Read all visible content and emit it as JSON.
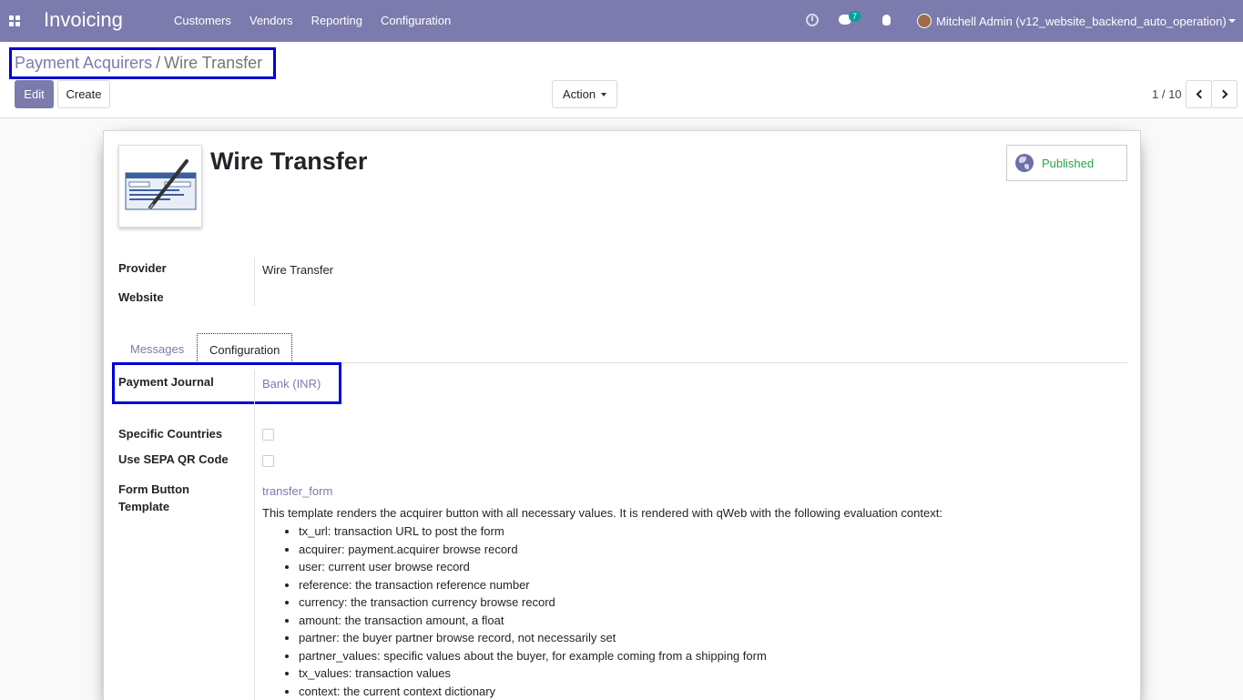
{
  "navbar": {
    "app_title": "Invoicing",
    "menu": [
      "Customers",
      "Vendors",
      "Reporting",
      "Configuration"
    ],
    "chat_count": "7",
    "user": "Mitchell Admin (v12_website_backend_auto_operation)"
  },
  "control_panel": {
    "breadcrumb_parent": "Payment Acquirers",
    "breadcrumb_separator": "/",
    "breadcrumb_current": "Wire Transfer",
    "edit_label": "Edit",
    "create_label": "Create",
    "action_label": "Action",
    "pager_value": "1 / 10"
  },
  "record": {
    "title": "Wire Transfer",
    "published_label": "Published",
    "provider_label": "Provider",
    "provider_value": "Wire Transfer",
    "website_label": "Website",
    "website_value": ""
  },
  "tabs": {
    "messages": "Messages",
    "configuration": "Configuration"
  },
  "config": {
    "payment_journal_label": "Payment Journal",
    "payment_journal_value": "Bank (INR)",
    "specific_countries_label": "Specific Countries",
    "specific_countries_checked": false,
    "sepa_qr_label": "Use SEPA QR Code",
    "sepa_qr_checked": false,
    "form_button_label_line1": "Form Button",
    "form_button_label_line2": "Template",
    "form_button_value": "transfer_form",
    "description": "This template renders the acquirer button with all necessary values. It is rendered with qWeb with the following evaluation context:",
    "context_items": [
      "tx_url: transaction URL to post the form",
      "acquirer: payment.acquirer browse record",
      "user: current user browse record",
      "reference: the transaction reference number",
      "currency: the transaction currency browse record",
      "amount: the transaction amount, a float",
      "partner: the buyer partner browse record, not necessarily set",
      "partner_values: specific values about the buyer, for example coming from a shipping form",
      "tx_values: transaction values",
      "context: the current context dictionary"
    ]
  },
  "colors": {
    "brand": "#7c7bad",
    "published": "#28a745",
    "highlight": "#0000d6"
  }
}
